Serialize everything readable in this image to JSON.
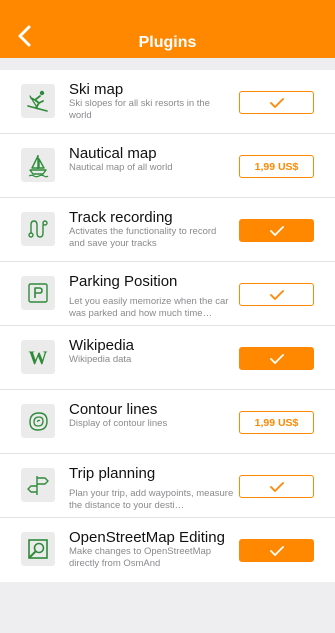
{
  "header": {
    "title": "Plugins",
    "back_icon": "chevron-left-icon"
  },
  "colors": {
    "accent": "#ff8800",
    "icon_green": "#2e8b3a"
  },
  "plugins": [
    {
      "name": "Ski map",
      "description": "Ski slopes for all ski resorts in the world",
      "icon": "skier-icon",
      "action": "installed-outline"
    },
    {
      "name": "Nautical map",
      "description": "Nautical map of all world",
      "icon": "sailboat-icon",
      "action": "price",
      "price": "1,99 US$"
    },
    {
      "name": "Track recording",
      "description": "Activates the functionality to record and save your tracks",
      "icon": "track-icon",
      "action": "enabled-filled"
    },
    {
      "name": "Parking Position",
      "description": "Let you easily memorize when the car was parked and how much time…",
      "icon": "parking-icon",
      "action": "installed-outline"
    },
    {
      "name": "Wikipedia",
      "description": "Wikipedia data",
      "icon": "wikipedia-icon",
      "action": "enabled-filled"
    },
    {
      "name": "Contour lines",
      "description": "Display of contour lines",
      "icon": "contour-icon",
      "action": "price",
      "price": "1,99 US$"
    },
    {
      "name": "Trip planning",
      "description": "Plan your trip, add waypoints, measure the distance to your desti…",
      "icon": "signpost-icon",
      "action": "installed-outline"
    },
    {
      "name": "OpenStreetMap Editing",
      "description": "Make changes to OpenStreetMap directly from OsmAnd",
      "icon": "osm-edit-icon",
      "action": "enabled-filled"
    }
  ]
}
